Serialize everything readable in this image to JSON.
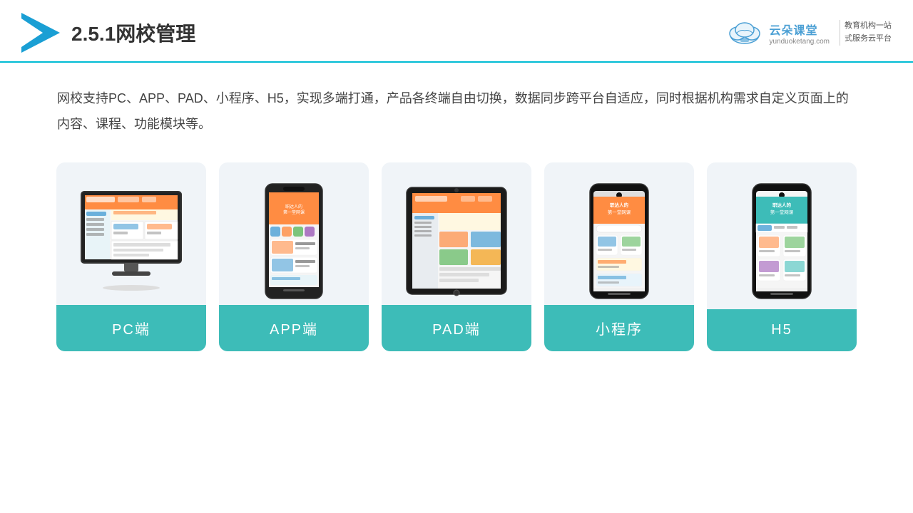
{
  "header": {
    "title_prefix": "2.5.1",
    "title_main": "网校管理",
    "brand": {
      "name": "云朵课堂",
      "url": "yunduoketang.com",
      "slogan": "教育机构一站\n式服务云平台"
    }
  },
  "description": {
    "text": "网校支持PC、APP、PAD、小程序、H5，实现多端打通，产品各终端自由切换，数据同步跨平台自适应，同时根据机构需求自定义页面上的内容、课程、功能模块等。"
  },
  "cards": [
    {
      "id": "pc",
      "label": "PC端"
    },
    {
      "id": "app",
      "label": "APP端"
    },
    {
      "id": "pad",
      "label": "PAD端"
    },
    {
      "id": "miniapp",
      "label": "小程序"
    },
    {
      "id": "h5",
      "label": "H5"
    }
  ]
}
